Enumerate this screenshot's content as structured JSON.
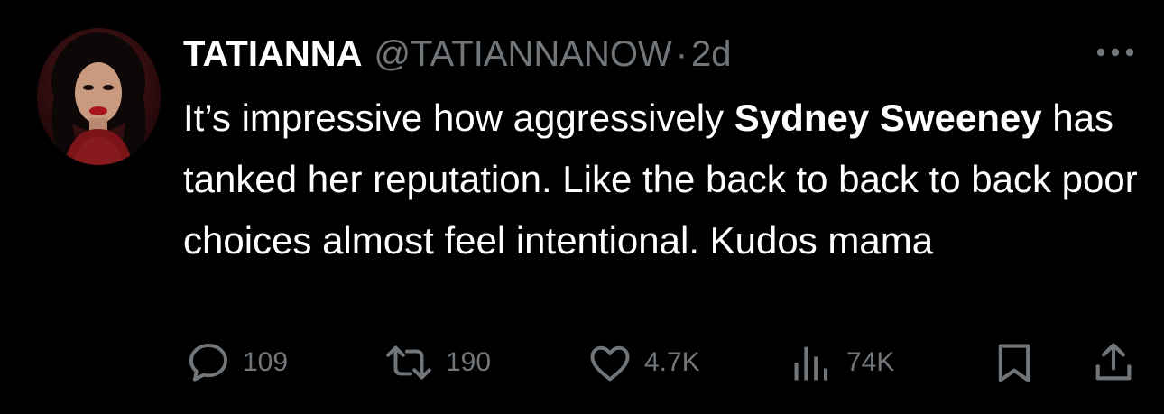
{
  "tweet": {
    "author": {
      "display_name": "TATIANNA",
      "handle": "@TATIANNANOW",
      "separator": "·",
      "time": "2d"
    },
    "text_segments": [
      {
        "text": "It’s impressive how aggressively ",
        "bold": false
      },
      {
        "text": "Sydney Sweeney",
        "bold": true
      },
      {
        "text": " has tanked her reputation. Like the back to back to back poor choices almost feel intentional. Kudos mama",
        "bold": false
      }
    ],
    "metrics": {
      "replies": "109",
      "reposts": "190",
      "likes": "4.7K",
      "views": "74K"
    },
    "icons": {
      "more": "more-horizontal-icon",
      "reply": "reply-bubble-icon",
      "repost": "repost-arrows-icon",
      "like": "heart-icon",
      "views": "bar-chart-icon",
      "bookmark": "bookmark-icon",
      "share": "share-upload-icon"
    }
  },
  "colors": {
    "background": "#000000",
    "text_primary": "#ffffff",
    "text_secondary": "#71767b"
  }
}
